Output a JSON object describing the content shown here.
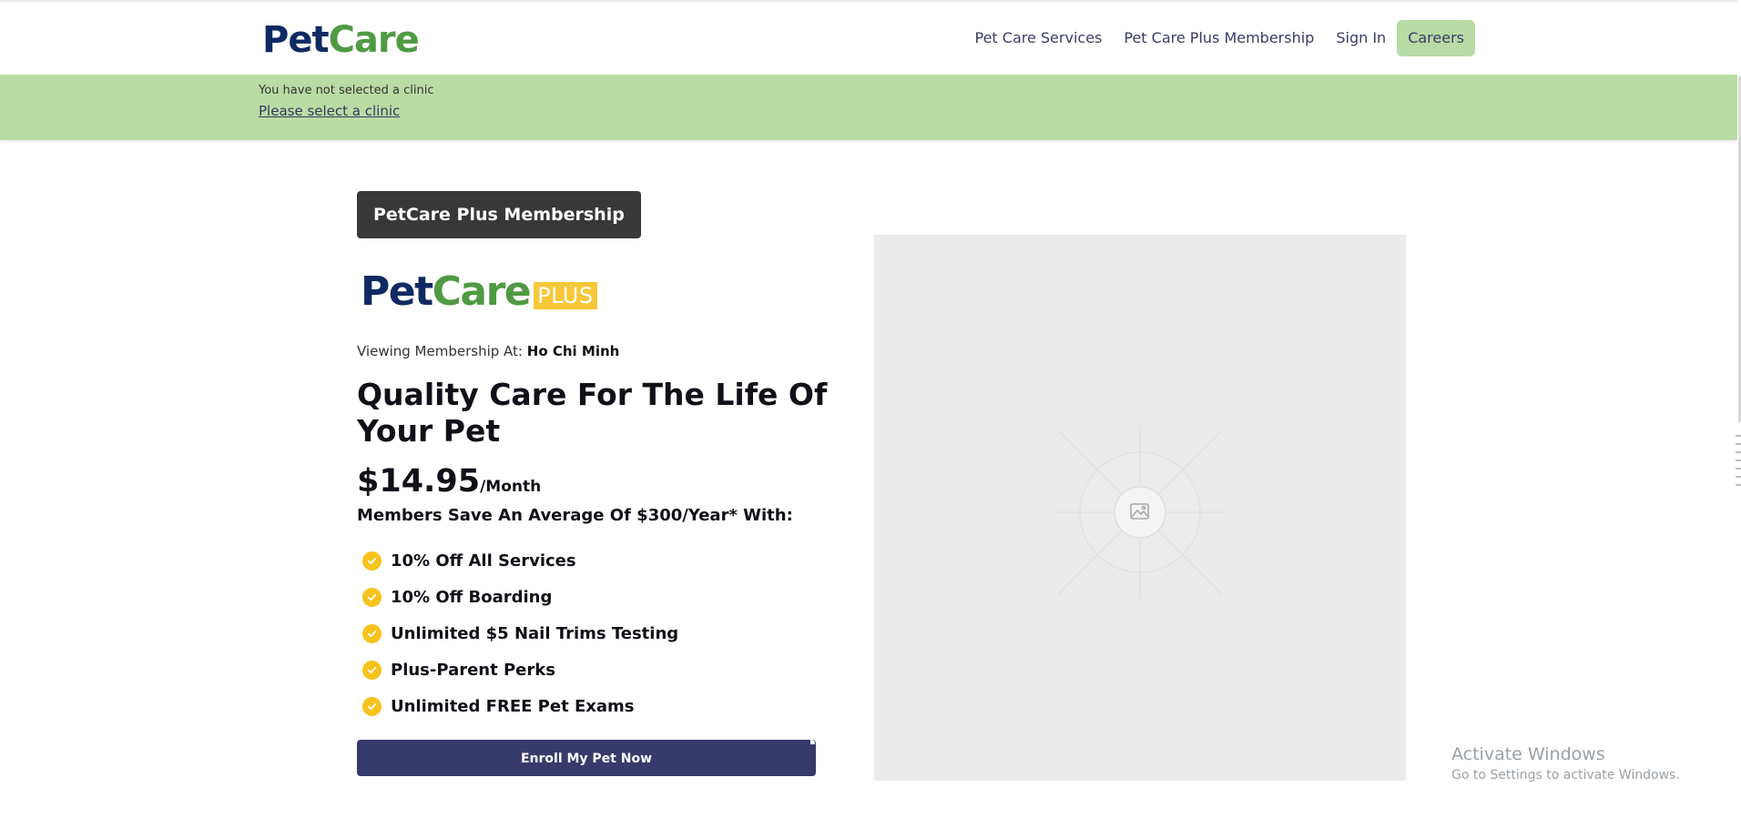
{
  "header": {
    "logo": {
      "part1": "Pet",
      "part2": "Care"
    },
    "nav": [
      {
        "label": "Pet Care Services"
      },
      {
        "label": "Pet Care Plus Membership"
      },
      {
        "label": "Sign In"
      },
      {
        "label": "Careers"
      }
    ]
  },
  "clinic_banner": {
    "message": "You have not selected a clinic",
    "link_label": "Please select a clinic"
  },
  "membership": {
    "badge": "PetCare Plus Membership",
    "plus_logo": {
      "part1": "Pet",
      "part2": "Care",
      "part3": "PLUS"
    },
    "viewing_label": "Viewing Membership At:",
    "location": "Ho Chi Minh",
    "headline": "Quality Care For The Life Of Your Pet",
    "price": "$14.95",
    "price_period": "/Month",
    "savings": "Members Save An Average Of $300/Year* With:",
    "benefits": [
      "10% Off All Services",
      "10% Off Boarding",
      "Unlimited $5 Nail Trims Testing",
      "Plus-Parent Perks",
      "Unlimited FREE Pet Exams"
    ],
    "enroll_label": "Enroll My Pet Now"
  },
  "system_overlay": {
    "title": "Activate Windows",
    "subtitle": "Go to Settings to activate Windows."
  },
  "icons": {
    "check": "check-circle-icon",
    "image_placeholder": "image-placeholder-icon"
  },
  "colors": {
    "brand_navy": "#0f2a63",
    "brand_green": "#4f9a43",
    "banner_green": "#b9dca5",
    "plus_yellow": "#f6c738",
    "button_navy": "#383a6c"
  }
}
